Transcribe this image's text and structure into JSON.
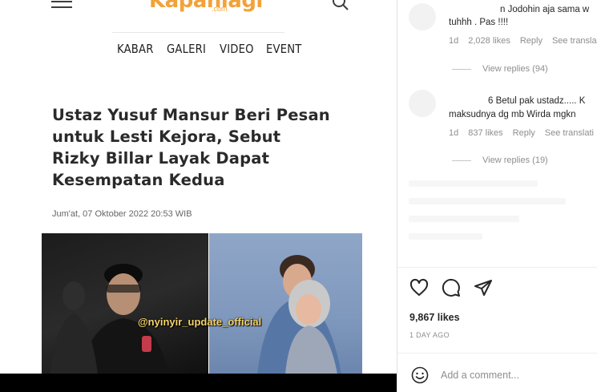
{
  "article": {
    "logo_text": "Kapanlagi",
    "logo_sub": ".com",
    "nav": [
      "KABAR",
      "GALERI",
      "VIDEO",
      "EVENT"
    ],
    "headline": "Ustaz Yusuf Mansur Beri Pesan untuk Lesti Kejora, Sebut Rizky Billar Layak Dapat Kesempatan Kedua",
    "date": "Jum'at, 07 Oktober 2022 20:53 WIB",
    "watermark": "@nyinyir_update_official"
  },
  "comments": [
    {
      "text": "n Jodohin aja sama w",
      "text2": "tuhhh . Pas !!!!",
      "time": "1d",
      "likes": "2,028 likes",
      "reply": "Reply",
      "translate": "See transla",
      "view_replies": "View replies (94)"
    },
    {
      "text": "6 Betul pak ustadz..... K",
      "text2": "maksudnya dg mb Wirda mgkn",
      "time": "1d",
      "likes": "837 likes",
      "reply": "Reply",
      "translate": "See translati",
      "view_replies": "View replies (19)"
    }
  ],
  "post": {
    "likes": "9,867 likes",
    "time_ago": "1 DAY AGO",
    "comment_placeholder": "Add a comment..."
  },
  "icons": {
    "menu": "hamburger-menu-icon",
    "search": "search-icon",
    "like": "heart-icon",
    "comment": "comment-bubble-icon",
    "share": "paper-plane-icon",
    "emoji": "emoji-smile-icon"
  },
  "colors": {
    "brand": "#f2a23a",
    "text_muted": "#8e8e8e"
  }
}
